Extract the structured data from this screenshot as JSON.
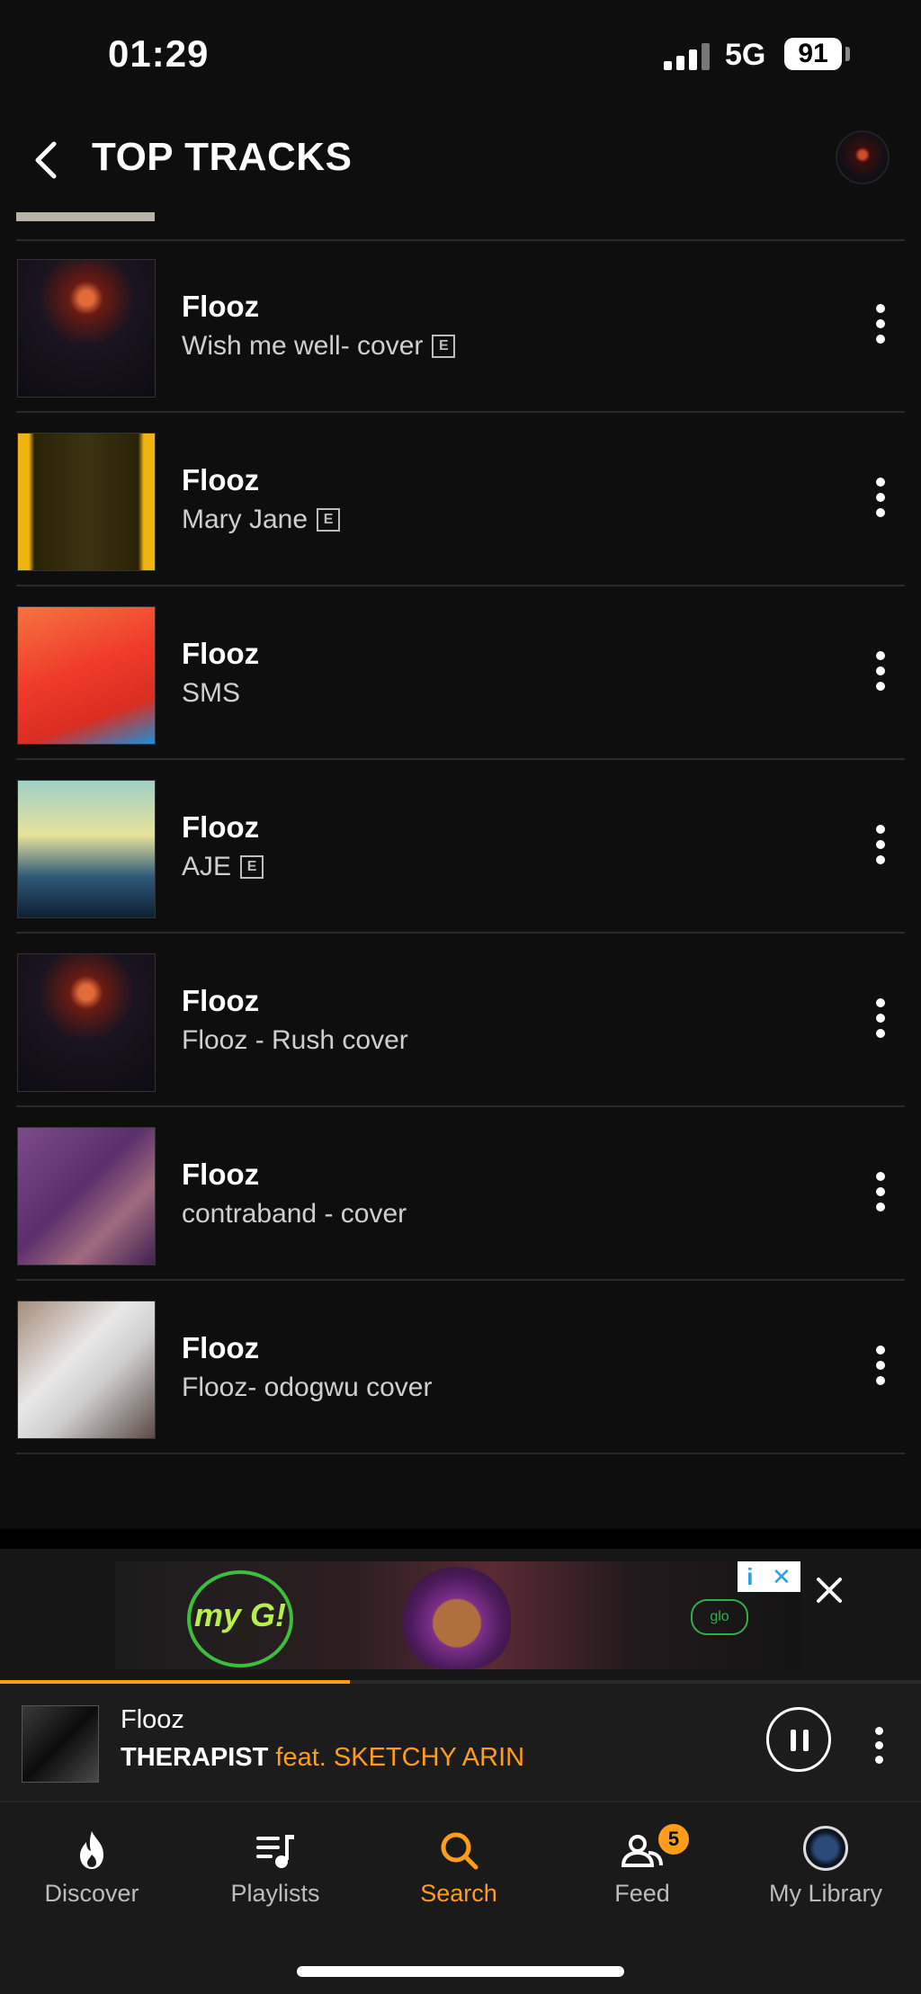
{
  "status_bar": {
    "time": "01:29",
    "network": "5G",
    "battery": "91"
  },
  "header": {
    "title": "TOP TRACKS"
  },
  "tracks": [
    {
      "artist": "Flooz",
      "title": "Wish me well- cover",
      "explicit": true
    },
    {
      "artist": "Flooz",
      "title": "Mary Jane",
      "explicit": true
    },
    {
      "artist": "Flooz",
      "title": "SMS",
      "explicit": false
    },
    {
      "artist": "Flooz",
      "title": "AJE",
      "explicit": true
    },
    {
      "artist": "Flooz",
      "title": "Flooz - Rush cover",
      "explicit": false
    },
    {
      "artist": "Flooz",
      "title": "contraband - cover",
      "explicit": false
    },
    {
      "artist": "Flooz",
      "title": "Flooz- odogwu cover",
      "explicit": false
    }
  ],
  "explicit_badge": "E",
  "ad": {
    "logo_text": "my G!",
    "brand": "glo",
    "info_label": "i",
    "close_label": "✕"
  },
  "now_playing": {
    "artist": "Flooz",
    "title": "THERAPIST",
    "featuring": "feat. SKETCHY ARIN",
    "progress": 0.38
  },
  "tabs": [
    {
      "label": "Discover",
      "icon": "flame-icon"
    },
    {
      "label": "Playlists",
      "icon": "playlist-icon"
    },
    {
      "label": "Search",
      "icon": "search-icon",
      "active": true
    },
    {
      "label": "Feed",
      "icon": "people-icon",
      "badge": "5"
    },
    {
      "label": "My Library",
      "icon": "avatar-icon"
    }
  ],
  "colors": {
    "accent": "#ff9c18",
    "background": "#0e0e0e",
    "player": "#1c1c1c"
  }
}
